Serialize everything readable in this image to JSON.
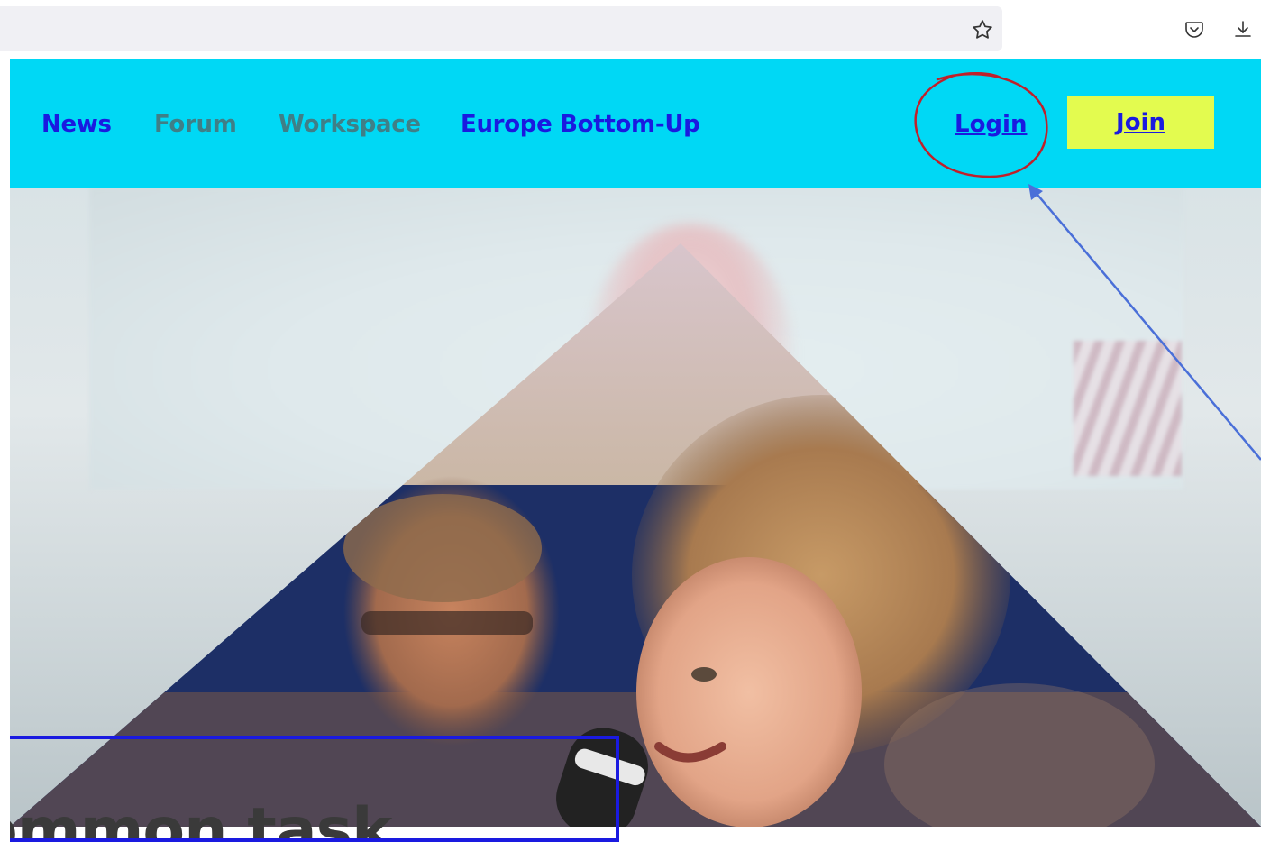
{
  "browser": {
    "bookmark_icon": "star-outline-icon",
    "pocket_icon": "pocket-icon",
    "download_icon": "download-icon"
  },
  "nav": {
    "items": [
      {
        "label": "News",
        "style": "primary"
      },
      {
        "label": "Forum",
        "style": "muted"
      },
      {
        "label": "Workspace",
        "style": "muted"
      },
      {
        "label": "Europe Bottom-Up",
        "style": "primary"
      }
    ],
    "login_label": "Login",
    "join_label": "Join"
  },
  "hero": {
    "heading_fragment": "ommon task"
  },
  "colors": {
    "nav_background": "#00d8f5",
    "nav_link_primary": "#1a1ae0",
    "nav_link_muted": "#3f7f87",
    "join_background": "#e3fb4f",
    "annotation_circle": "#c0202a",
    "annotation_arrow": "#4a6fd8",
    "box_border": "#1a1ae0"
  }
}
